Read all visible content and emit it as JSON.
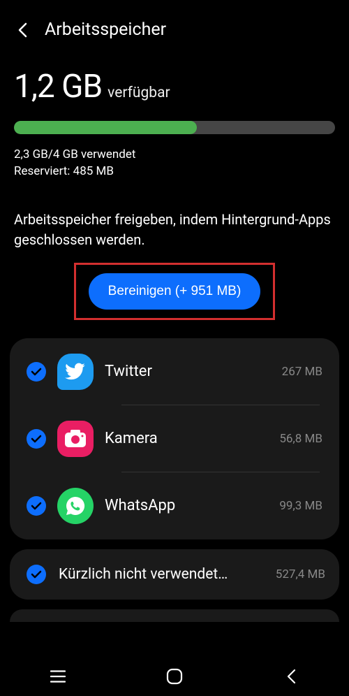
{
  "header": {
    "title": "Arbeitsspeicher"
  },
  "memory": {
    "available_value": "1,2 GB",
    "available_label": "verfügbar",
    "progress_percent": 57,
    "usage_line1": "2,3 GB/4 GB verwendet",
    "usage_line2": "Reserviert: 485 MB"
  },
  "description": "Arbeitsspeicher freigeben, indem Hintergrund-Apps geschlossen werden.",
  "clean_button": "Bereinigen (+ 951 MB)",
  "apps": [
    {
      "name": "Twitter",
      "size": "267 MB",
      "iconClass": "twitter-icon"
    },
    {
      "name": "Kamera",
      "size": "56,8 MB",
      "iconClass": "camera-icon"
    },
    {
      "name": "WhatsApp",
      "size": "99,3 MB",
      "iconClass": "whatsapp-icon"
    }
  ],
  "recent": {
    "label": "Kürzlich nicht verwendet…",
    "size": "527,4 MB"
  }
}
